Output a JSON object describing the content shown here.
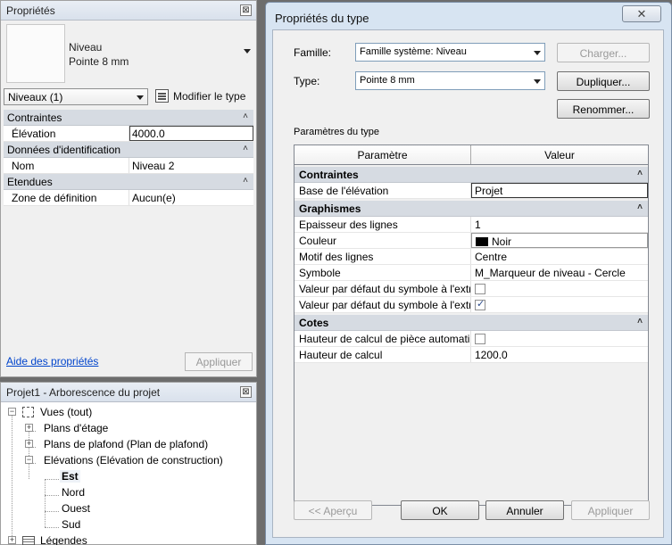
{
  "properties_palette": {
    "title": "Propriétés",
    "close_glyph": "⊠",
    "type_name_line1": "Niveau",
    "type_name_line2": "Pointe 8 mm",
    "filter_value": "Niveaux (1)",
    "edit_type_label": "Modifier le type",
    "sections": [
      {
        "label": "Contraintes",
        "rows": [
          {
            "key": "Élévation",
            "value": "4000.0"
          }
        ]
      },
      {
        "label": "Données d'identification",
        "rows": [
          {
            "key": "Nom",
            "value": "Niveau 2"
          }
        ]
      },
      {
        "label": "Etendues",
        "rows": [
          {
            "key": "Zone de définition",
            "value": "Aucun(e)"
          }
        ]
      }
    ],
    "help_link": "Aide des propriétés",
    "apply_label": "Appliquer",
    "collapse_glyph": "˄"
  },
  "project_browser": {
    "title": "Projet1 - Arborescence du projet",
    "close_glyph": "⊠",
    "items": [
      {
        "label": "Vues (tout)"
      },
      {
        "label": "Plans d'étage"
      },
      {
        "label": "Plans de plafond (Plan de plafond)"
      },
      {
        "label": "Elévations (Elévation de construction)"
      },
      {
        "label": "Est"
      },
      {
        "label": "Nord"
      },
      {
        "label": "Ouest"
      },
      {
        "label": "Sud"
      },
      {
        "label": "Légendes"
      }
    ],
    "expander_plus": "+",
    "expander_minus": "−"
  },
  "type_dialog": {
    "title": "Propriétés du type",
    "close_glyph": "✕",
    "family_label": "Famille:",
    "family_value": "Famille système: Niveau",
    "type_label": "Type:",
    "type_value": "Pointe 8 mm",
    "load_button": "Charger...",
    "duplicate_button": "Dupliquer...",
    "rename_button": "Renommer...",
    "params_caption": "Paramètres du type",
    "col_param": "Paramètre",
    "col_value": "Valeur",
    "collapse_glyph": "˄",
    "sections": [
      {
        "label": "Contraintes",
        "rows": [
          {
            "key": "Base de l'élévation",
            "value": "Projet"
          }
        ]
      },
      {
        "label": "Graphismes",
        "rows": [
          {
            "key": "Epaisseur des lignes",
            "value": "1"
          },
          {
            "key": "Couleur",
            "value": "Noir"
          },
          {
            "key": "Motif des lignes",
            "value": "Centre"
          },
          {
            "key": "Symbole",
            "value": "M_Marqueur de niveau - Cercle"
          },
          {
            "key": "Valeur par défaut du symbole à l'extr",
            "value": ""
          },
          {
            "key": "Valeur par défaut du symbole à l'extr",
            "value": ""
          }
        ]
      },
      {
        "label": "Cotes",
        "rows": [
          {
            "key": "Hauteur de calcul de pièce automati",
            "value": ""
          },
          {
            "key": "Hauteur de calcul",
            "value": "1200.0"
          }
        ]
      }
    ],
    "color_swatch": "#000000",
    "preview_button": "<< Aperçu",
    "ok_button": "OK",
    "cancel_button": "Annuler",
    "apply_button": "Appliquer"
  }
}
